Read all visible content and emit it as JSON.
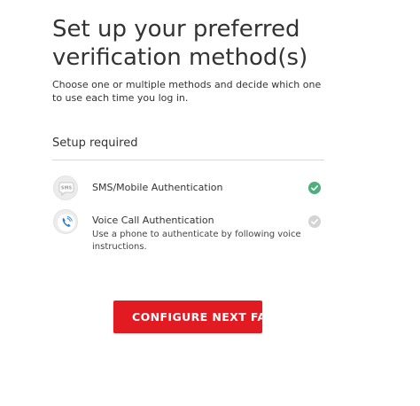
{
  "header": {
    "title": "Set up your preferred verification method(s)",
    "subtitle": "Choose one or multiple methods and decide which one to use each time you log in."
  },
  "setup": {
    "heading": "Setup required",
    "methods": [
      {
        "name": "SMS/Mobile Authentication",
        "icon_text": "SMS",
        "icon": "sms-bubble-icon",
        "status": "complete",
        "status_color": "#4caf7d"
      },
      {
        "name": "Voice Call Authentication",
        "description": "Use a phone to authenticate by following voice instructions.",
        "icon": "phone-icon",
        "status": "incomplete",
        "status_color": "#d4d4d4"
      }
    ]
  },
  "actions": {
    "configure_label": "CONFIGURE NEXT FA"
  },
  "colors": {
    "accent": "#e21b23",
    "phone_icon": "#2a7fd4"
  }
}
